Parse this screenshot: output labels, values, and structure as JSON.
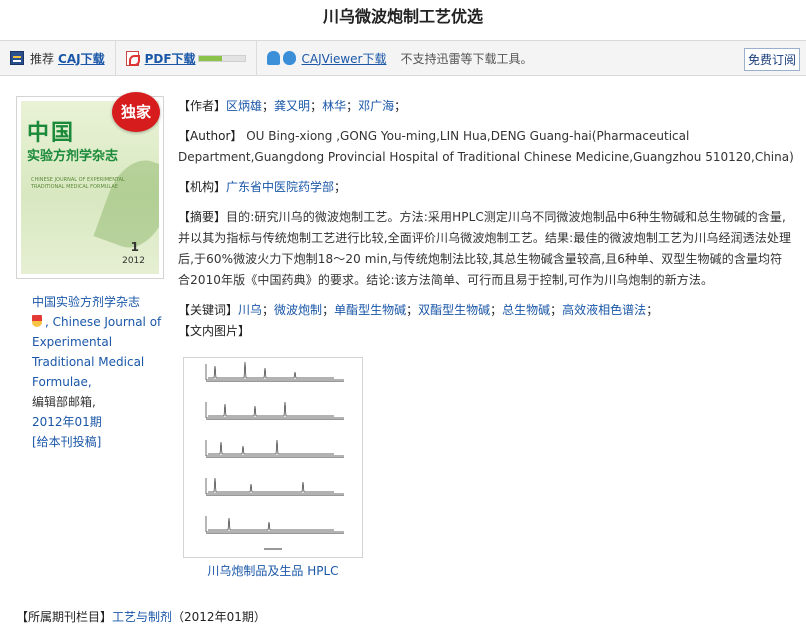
{
  "title": "川乌微波炮制工艺优选",
  "toolbar": {
    "recommend_label": "推荐",
    "caj_download": "CAJ下载",
    "pdf_download": "PDF下载",
    "pdf_progress": 0.5,
    "cajviewer_download": "CAJViewer下载",
    "note": "不支持迅雷等下载工具。",
    "subscribe": "免费订阅"
  },
  "journal": {
    "cover": {
      "title_line1": "中国",
      "title_line2": "实验方剂学杂志",
      "en_title": "CHINESE JOURNAL OF EXPERIMENTAL TRADITIONAL MEDICAL FORMULAE",
      "issue_number": "1",
      "year": "2012",
      "badge": "独家"
    },
    "name_cn": "中国实验方剂学杂志",
    "name_en": ", Chinese Journal of Experimental Traditional Medical Formulae,",
    "mailbox": "编辑部邮箱,",
    "issue": "2012年01期",
    "submit": "[给本刊投稿]"
  },
  "article": {
    "authors_label": "【作者】",
    "authors": [
      "区炳雄",
      "龚又明",
      "林华",
      "邓广海"
    ],
    "author_en_label": "【Author】",
    "author_en": "OU Bing-xiong ,GONG You-ming,LIN Hua,DENG Guang-hai(Pharmaceutical Department,Guangdong Provincial Hospital of Traditional Chinese Medicine,Guangzhou 510120,China)",
    "institution_label": "【机构】",
    "institution": "广东省中医院药学部",
    "abstract_label": "【摘要】",
    "abstract": "目的:研究川乌的微波炮制工艺。方法:采用HPLC测定川乌不同微波炮制品中6种生物碱和总生物碱的含量,并以其为指标与传统炮制工艺进行比较,全面评价川乌微波炮制工艺。结果:最佳的微波炮制工艺为川乌经润透法处理后,于60%微波火力下炮制18～20 min,与传统炮制法比较,其总生物碱含量较高,且6种单、双型生物碱的含量均符合2010年版《中国药典》的要求。结论:该方法简单、可行而且易于控制,可作为川乌炮制的新方法。",
    "keywords_label": "【关键词】",
    "keywords": [
      "川乌",
      "微波炮制",
      "单酯型生物碱",
      "双酯型生物碱",
      "总生物碱",
      "高效液相色谱法"
    ],
    "images_label": "【文内图片】",
    "figure_caption": "川乌炮制品及生品 HPLC"
  },
  "footer": {
    "label": "【所属期刊栏目】",
    "section": "工艺与制剂",
    "issue": "（2012年01期）"
  }
}
